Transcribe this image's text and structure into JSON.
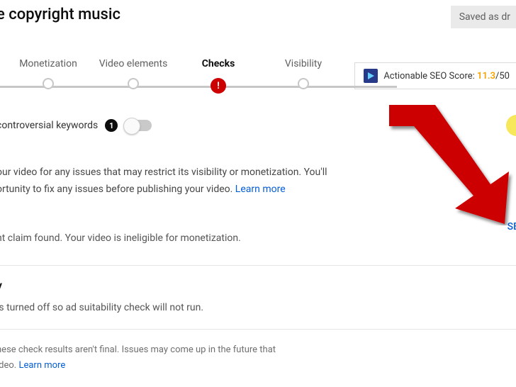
{
  "header": {
    "title": "e copyright music",
    "saved": "Saved as dr"
  },
  "stepper": {
    "items": [
      {
        "label": "Monetization",
        "state": "default"
      },
      {
        "label": "Video elements",
        "state": "default"
      },
      {
        "label": "Checks",
        "state": "alert"
      },
      {
        "label": "Visibility",
        "state": "default"
      }
    ]
  },
  "seo": {
    "prefix": "Actionable SEO Score: ",
    "score": "11.3",
    "total": "/50"
  },
  "keywords": {
    "label": "controversial keywords",
    "badge": "1"
  },
  "body": {
    "line1": "our video for any issues that may restrict its visibility or monetization. You'll",
    "line2": "ortunity to fix any issues before publishing your video. ",
    "learn": "Learn more"
  },
  "claim": {
    "text": "ht claim found. Your video is ineligible for monetization.",
    "see": "SE"
  },
  "adsuit": {
    "head": "y",
    "text": "is turned off so ad suitability check will not run."
  },
  "footer": {
    "line1": "nese check results aren't final. Issues may come up in the future that",
    "line2": "ideo. ",
    "learn": "Learn more"
  }
}
